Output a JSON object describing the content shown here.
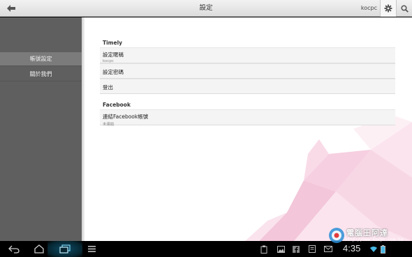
{
  "action_bar": {
    "title": "設定",
    "user": "kocpc"
  },
  "sidebar": {
    "items": [
      {
        "label": "帳號設定",
        "selected": true
      },
      {
        "label": "關於我們",
        "selected": false
      }
    ]
  },
  "main": {
    "sections": [
      {
        "header": "Timely",
        "items": [
          {
            "title": "設定暱稱",
            "subtitle": "kocpc"
          },
          {
            "title": "設定密碼",
            "subtitle": ""
          },
          {
            "title": "登出",
            "subtitle": ""
          }
        ]
      },
      {
        "header": "Facebook",
        "items": [
          {
            "title": "連結Facebook帳號",
            "subtitle": "未連結"
          }
        ]
      }
    ]
  },
  "status_bar": {
    "time": "4:35"
  },
  "watermark": {
    "text": "電腦王阿達",
    "url": "http://www.kocpc.com.tw"
  },
  "colors": {
    "sidebar": "#5f5f5f",
    "sidebar_selected": "#7b7b7b",
    "accent_nav": "#0d4c66",
    "decor_pink": "#f3c6d9"
  }
}
